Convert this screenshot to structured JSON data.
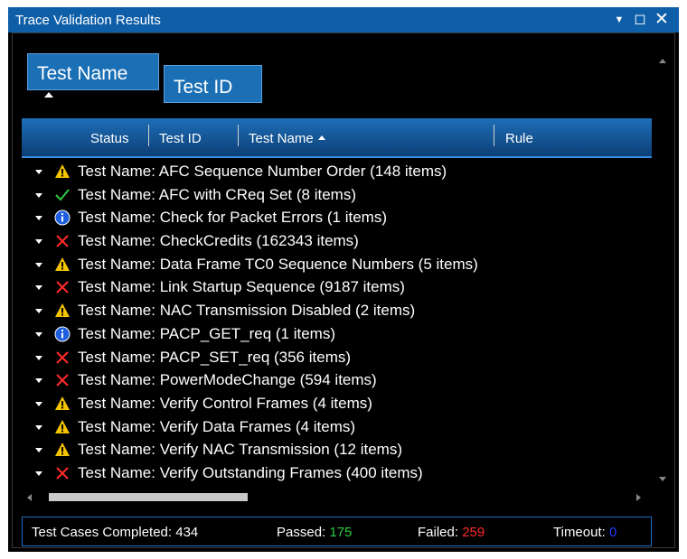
{
  "window": {
    "title": "Trace Validation Results"
  },
  "group_panel": {
    "chips": [
      {
        "label": "Test Name"
      },
      {
        "label": "Test ID"
      }
    ]
  },
  "grid": {
    "columns": [
      "Status",
      "Test ID",
      "Test Name",
      "Rule"
    ],
    "rows": [
      {
        "status": "warning",
        "text": "Test Name: AFC Sequence Number Order (148 items)"
      },
      {
        "status": "pass",
        "text": "Test Name: AFC with CReq Set (8 items)"
      },
      {
        "status": "info",
        "text": "Test Name: Check for Packet Errors (1 items)"
      },
      {
        "status": "fail",
        "text": "Test Name: CheckCredits (162343 items)"
      },
      {
        "status": "warning",
        "text": "Test Name: Data Frame TC0 Sequence Numbers (5 items)"
      },
      {
        "status": "fail",
        "text": "Test Name: Link Startup Sequence (9187 items)"
      },
      {
        "status": "warning",
        "text": "Test Name: NAC Transmission Disabled (2 items)"
      },
      {
        "status": "info",
        "text": "Test Name: PACP_GET_req (1 items)"
      },
      {
        "status": "fail",
        "text": "Test Name: PACP_SET_req (356 items)"
      },
      {
        "status": "fail",
        "text": "Test Name: PowerModeChange (594 items)"
      },
      {
        "status": "warning",
        "text": "Test Name: Verify Control Frames (4 items)"
      },
      {
        "status": "warning",
        "text": "Test Name: Verify Data Frames (4 items)"
      },
      {
        "status": "warning",
        "text": "Test Name: Verify NAC Transmission (12 items)"
      },
      {
        "status": "fail",
        "text": "Test Name: Verify Outstanding Frames (400 items)"
      }
    ]
  },
  "summary": {
    "completed_label": "Test Cases Completed: 434",
    "passed_label": "Passed:",
    "passed_value": "175",
    "failed_label": "Failed:",
    "failed_value": "259",
    "timeout_label": "Timeout:",
    "timeout_value": "0"
  },
  "colors": {
    "titlebar": "#0f5fa8",
    "accent": "#1b6fb5",
    "pass": "#2ecc40",
    "fail": "#ff2a2a",
    "warning": "#f5c400",
    "info": "#1e5fe0",
    "timeout": "#1f3fff"
  },
  "icons": {
    "warning": "warning-icon",
    "pass": "check-icon",
    "info": "info-icon",
    "fail": "x-icon"
  }
}
